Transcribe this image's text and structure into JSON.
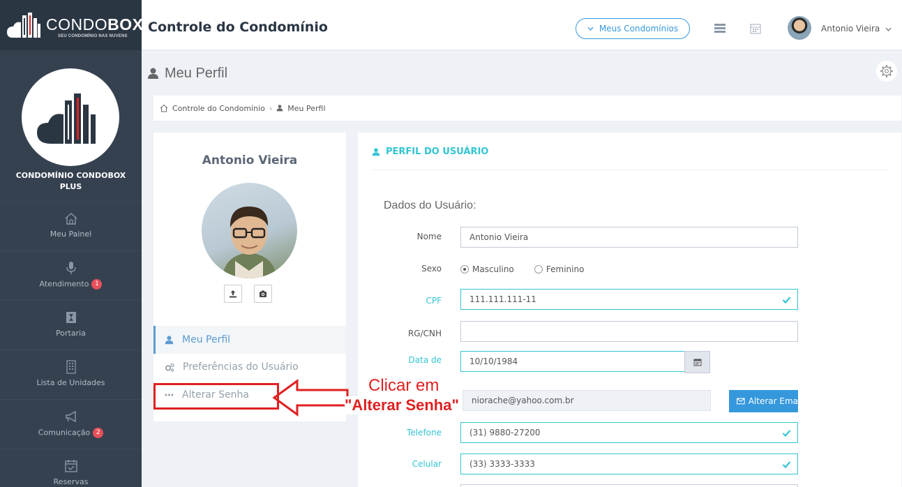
{
  "header": {
    "logo_main": "CONDO",
    "logo_bold": "BOX",
    "logo_tagline": "SEU CONDOMÍNIO NAS NUVENS",
    "title": "Controle do Condomínio",
    "condo_button": "Meus Condomínios",
    "user_name": "Antonio Vieira",
    "icons": [
      "chevron-down-icon",
      "list-icon",
      "calendar-icon",
      "user-avatar",
      "chevron-down-icon"
    ]
  },
  "sidebar": {
    "condo_name": "CONDOMÍNIO CONDOBOX PLUS",
    "items": [
      {
        "label": "Meu Painel",
        "icon": "home-icon",
        "badge": ""
      },
      {
        "label": "Atendimento",
        "icon": "microphone-icon",
        "badge": "1"
      },
      {
        "label": "Portaria",
        "icon": "doorman-icon",
        "badge": ""
      },
      {
        "label": "Lista de Unidades",
        "icon": "building-icon",
        "badge": ""
      },
      {
        "label": "Comunicação",
        "icon": "megaphone-icon",
        "badge": "2"
      },
      {
        "label": "Reservas",
        "icon": "calendar-check-icon",
        "badge": ""
      }
    ]
  },
  "page": {
    "title": "Meu Perfil",
    "breadcrumb": [
      "Controle do Condomínio",
      "Meu Perfil"
    ]
  },
  "profile": {
    "name": "Antonio Vieira",
    "menu": [
      {
        "label": "Meu Perfil",
        "icon": "user-icon",
        "active": true
      },
      {
        "label": "Preferências do Usuário",
        "icon": "cogs-icon",
        "active": false
      },
      {
        "label": "Alterar Senha",
        "icon": "dots-icon",
        "active": false
      }
    ]
  },
  "form": {
    "section_title": "PERFIL DO USUÁRIO",
    "subtitle": "Dados do Usuário:",
    "fields": {
      "nome": {
        "label": "Nome",
        "value": "Antonio Vieira"
      },
      "sexo": {
        "label": "Sexo",
        "options": [
          "Masculino",
          "Feminino"
        ],
        "selected": "Masculino"
      },
      "cpf": {
        "label": "CPF",
        "value": "111.111.111-11"
      },
      "rg": {
        "label": "RG/CNH",
        "value": ""
      },
      "nascimento": {
        "label": "Data de",
        "value": "10/10/1984"
      },
      "email": {
        "value": "niorache@yahoo.com.br",
        "button": "Alterar Ema"
      },
      "telefone": {
        "label": "Telefone",
        "value": "(31) 9880-27200"
      },
      "celular": {
        "label": "Celular",
        "value": "(33) 3333-3333"
      }
    }
  },
  "annotation": {
    "line1": "Clicar em",
    "line2": "\"Alterar Senha\"",
    "color": "#e02020"
  },
  "colors": {
    "sidebar": "#364150",
    "accent": "#32c5d2",
    "primary": "#3598dc",
    "badge": "#e7505a"
  }
}
